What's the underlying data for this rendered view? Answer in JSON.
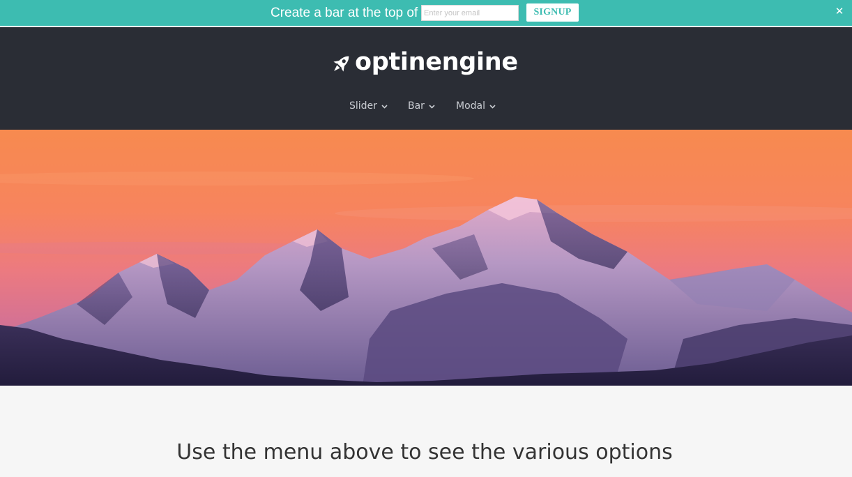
{
  "topbar": {
    "message": "Create a bar at the top of",
    "email_placeholder": "Enter your email",
    "signup_label": "SIGNUP",
    "close_label": "✕",
    "background_color": "#3dbcb1"
  },
  "header": {
    "logo_text": "optinengine",
    "logo_icon": "rocket-icon",
    "background_color": "#2a2d35",
    "nav": [
      {
        "label": "Slider",
        "icon": "chevron-down-icon"
      },
      {
        "label": "Bar",
        "icon": "chevron-down-icon"
      },
      {
        "label": "Modal",
        "icon": "chevron-down-icon"
      }
    ]
  },
  "hero": {
    "image": "mountain-sunset-image"
  },
  "content": {
    "headline": "Use the menu above to see the various options"
  }
}
